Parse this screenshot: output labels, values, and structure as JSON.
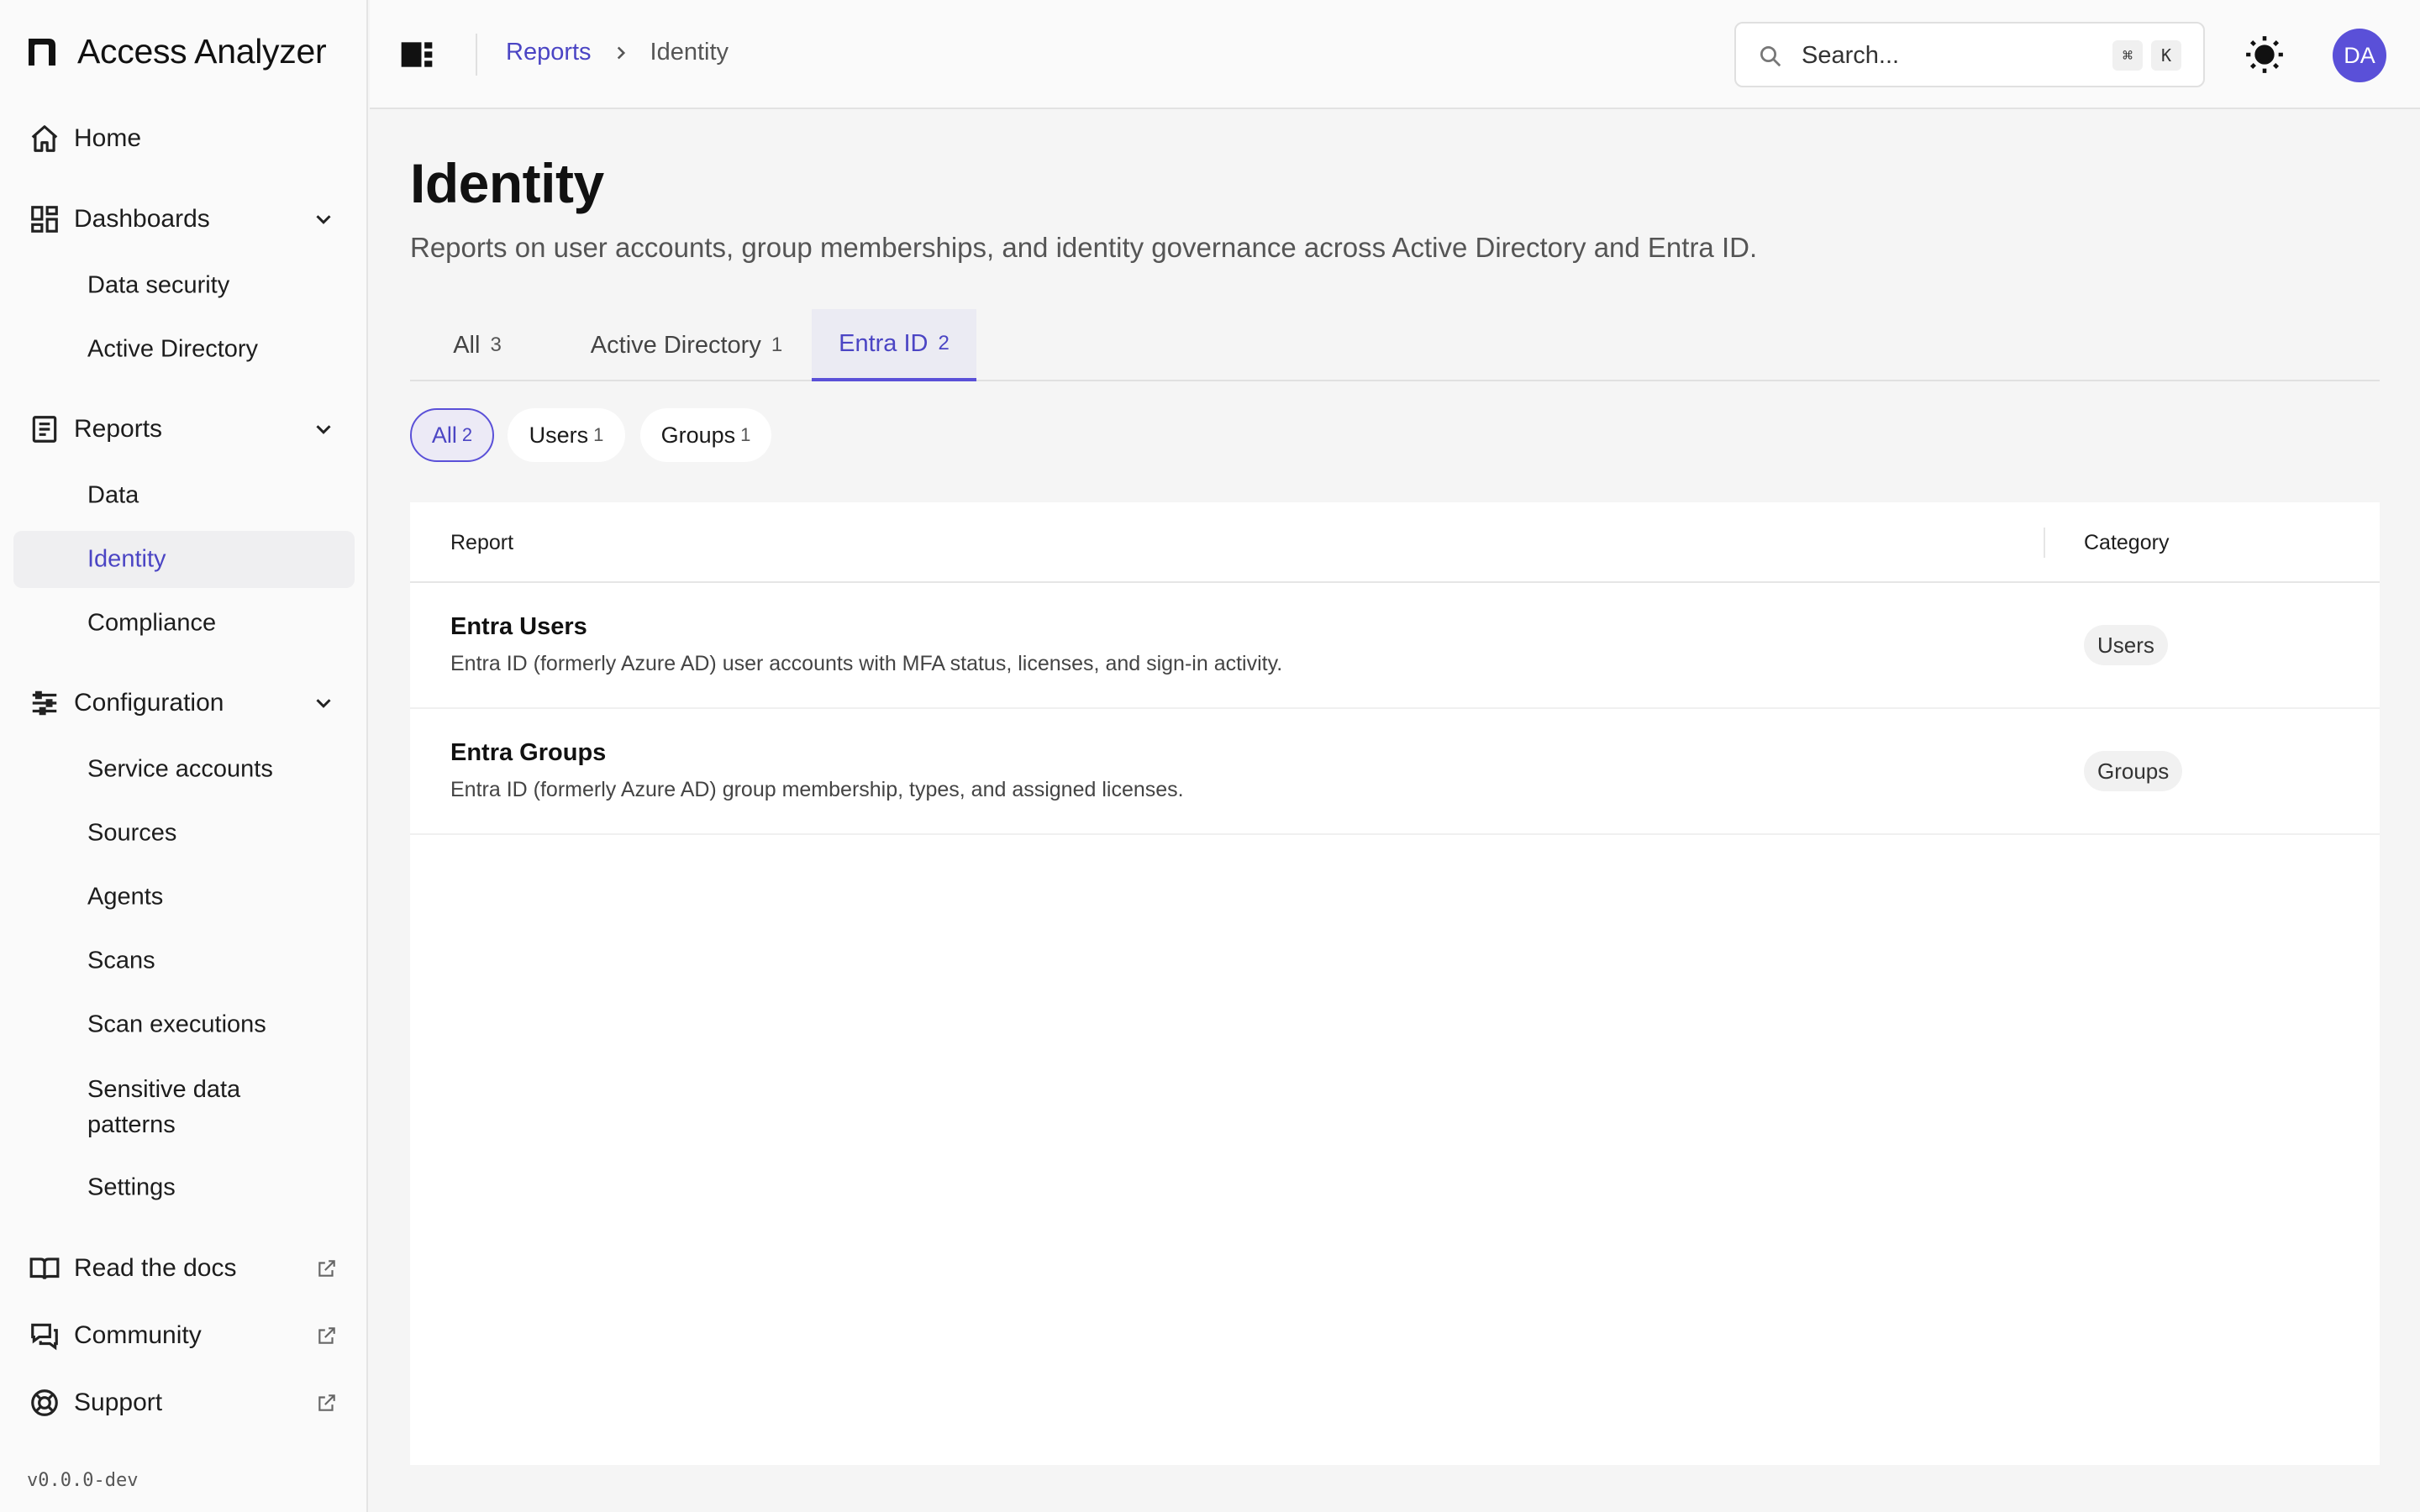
{
  "app": {
    "name": "Access Analyzer",
    "version": "v0.0.0-dev"
  },
  "sidebar": {
    "home": "Home",
    "dashboards": {
      "label": "Dashboards",
      "items": [
        "Data security",
        "Active Directory"
      ]
    },
    "reports": {
      "label": "Reports",
      "items": [
        "Data",
        "Identity",
        "Compliance"
      ],
      "active": "Identity"
    },
    "configuration": {
      "label": "Configuration",
      "items": [
        "Service accounts",
        "Sources",
        "Agents",
        "Scans",
        "Scan executions",
        "Sensitive data patterns",
        "Settings"
      ]
    },
    "links": [
      "Read the docs",
      "Community",
      "Support"
    ]
  },
  "header": {
    "breadcrumb": [
      "Reports",
      "Identity"
    ],
    "search": {
      "placeholder": "Search...",
      "shortcut": [
        "⌘",
        "K"
      ]
    },
    "avatar_initials": "DA"
  },
  "page": {
    "title": "Identity",
    "description": "Reports on user accounts, group memberships, and identity governance across Active Directory and Entra ID."
  },
  "tabs": [
    {
      "label": "All",
      "count": "3"
    },
    {
      "label": "Active Directory",
      "count": "1"
    },
    {
      "label": "Entra ID",
      "count": "2",
      "active": true
    }
  ],
  "filters": [
    {
      "label": "All",
      "count": "2",
      "active": true
    },
    {
      "label": "Users",
      "count": "1"
    },
    {
      "label": "Groups",
      "count": "1"
    }
  ],
  "table": {
    "columns": [
      "Report",
      "Category"
    ],
    "rows": [
      {
        "title": "Entra Users",
        "description": "Entra ID (formerly Azure AD) user accounts with MFA status, licenses, and sign-in activity.",
        "category": "Users"
      },
      {
        "title": "Entra Groups",
        "description": "Entra ID (formerly Azure AD) group membership, types, and assigned licenses.",
        "category": "Groups"
      }
    ]
  },
  "colors": {
    "accent": "#5a50d8",
    "accent_text": "#4b45c4",
    "background": "#f5f5f5",
    "sidebar": "#fafafa"
  }
}
